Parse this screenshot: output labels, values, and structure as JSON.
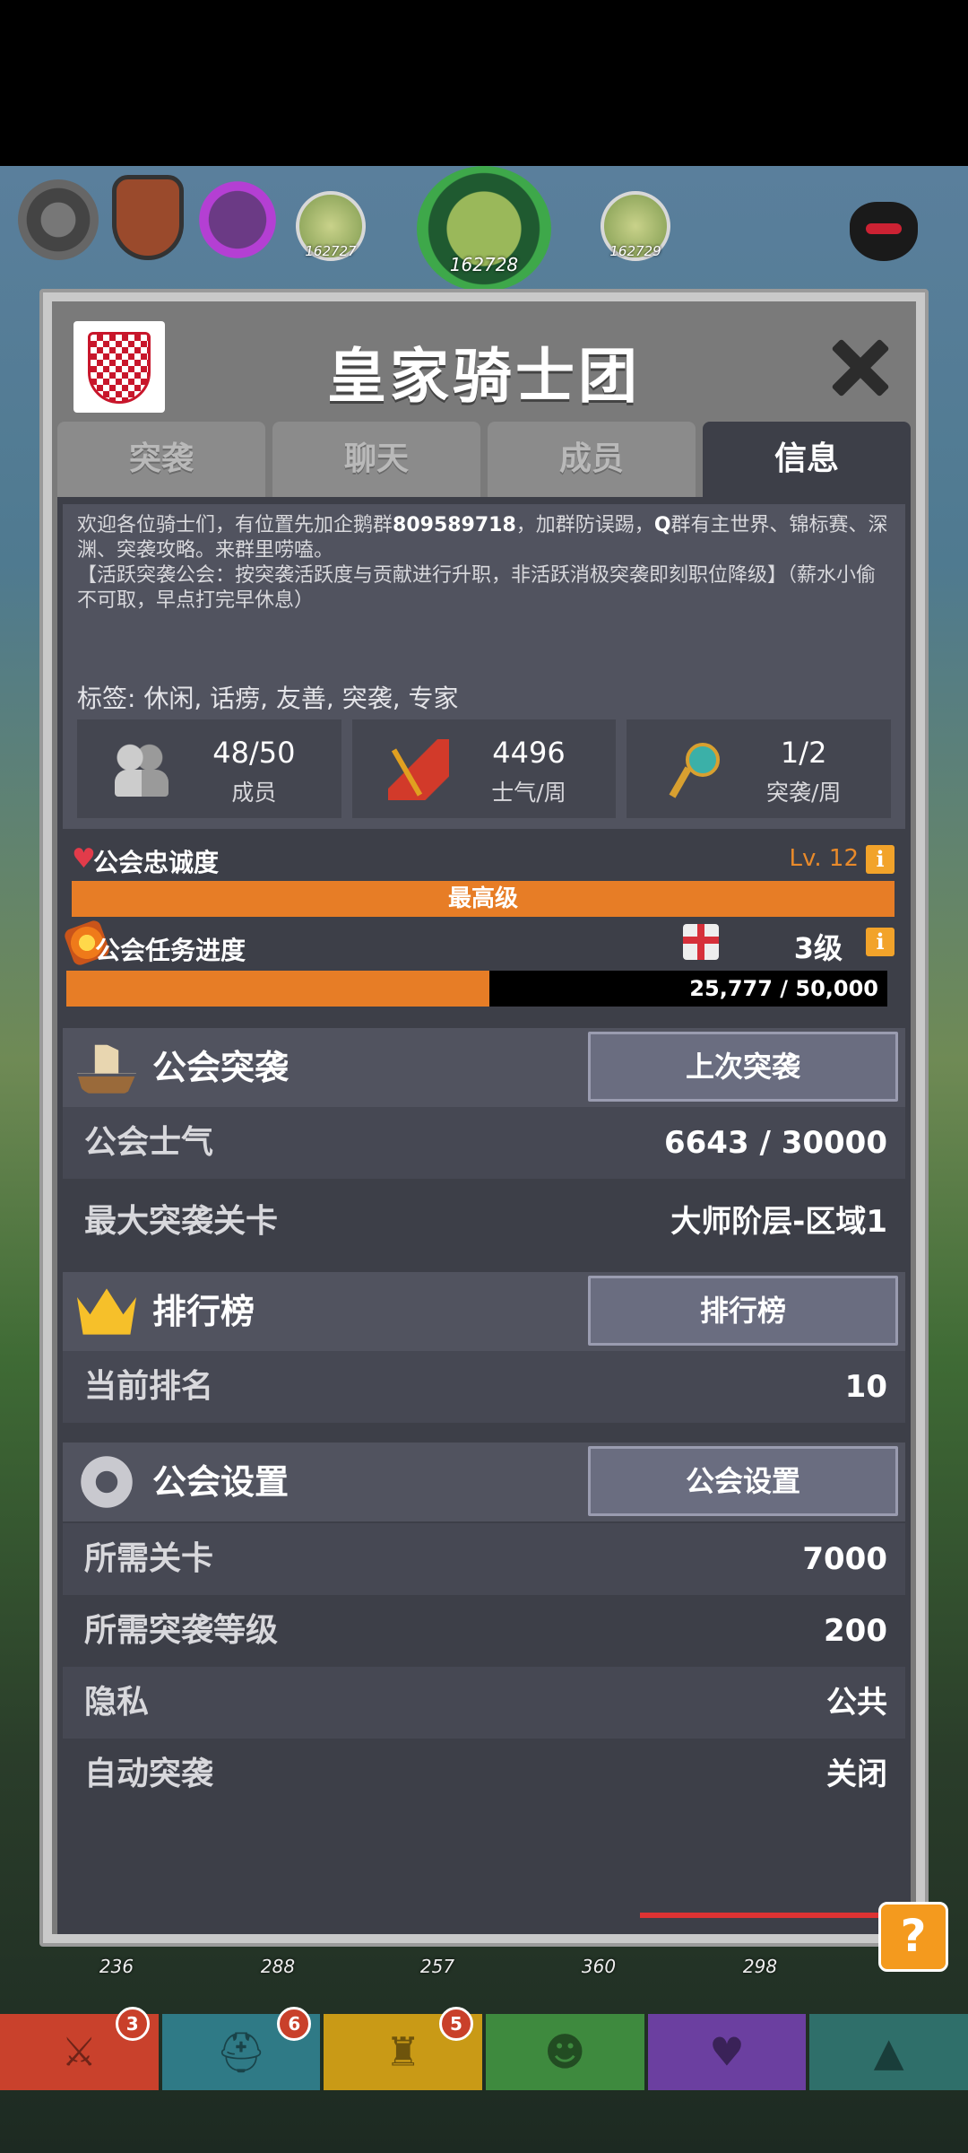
{
  "hud": {
    "levels": [
      {
        "label": "162727"
      },
      {
        "label": "162728"
      },
      {
        "label": "162729"
      }
    ]
  },
  "modal": {
    "title": "皇家骑士团",
    "tabs": [
      {
        "label": "突袭"
      },
      {
        "label": "聊天"
      },
      {
        "label": "成员"
      },
      {
        "label": "信息"
      }
    ],
    "active_tab": "信息",
    "description_lines": [
      "欢迎各位骑士们，有位置先加企鹅群",
      "809589718",
      "，加群防误踢，",
      "Q",
      "群有主世界、锦标赛、深渊、突袭攻略。来群里唠嗑。",
      "【活跃突袭公会：按突袭活跃度与贡献进行升职，非活跃消极突袭即刻职位降级】（薪水小偷不可取，早点打完早休息）"
    ],
    "tags": "标签: 休闲, 话痨, 友善, 突袭, 专家",
    "stats": [
      {
        "value": "48/50",
        "label": "成员",
        "icon": "people-icon"
      },
      {
        "value": "4496",
        "label": "士气/周",
        "icon": "flag-icon"
      },
      {
        "value": "1/2",
        "label": "突袭/周",
        "icon": "key-icon"
      }
    ],
    "loyalty": {
      "label": "公会忠诚度",
      "level": "Lv. 12",
      "bar_text": "最高级"
    },
    "task": {
      "label": "公会任务进度",
      "grade": "3级",
      "progress_text": "25,777 / 50,000",
      "current": 25777,
      "max": 50000
    },
    "raid_section": {
      "title": "公会突袭",
      "button": "上次突袭",
      "rows": [
        {
          "key": "公会士气",
          "value": "6643 / 30000"
        },
        {
          "key": "最大突袭关卡",
          "value": "大师阶层-区域1"
        }
      ]
    },
    "rank_section": {
      "title": "排行榜",
      "button": "排行榜",
      "rows": [
        {
          "key": "当前排名",
          "value": "10"
        }
      ]
    },
    "settings_section": {
      "title": "公会设置",
      "button": "公会设置",
      "rows": [
        {
          "key": "所需关卡",
          "value": "7000"
        },
        {
          "key": "所需突袭等级",
          "value": "200"
        },
        {
          "key": "隐私",
          "value": "公共"
        },
        {
          "key": "自动突袭",
          "value": "关闭"
        }
      ]
    }
  },
  "help_button": "?",
  "bottom": {
    "bubbles": [
      "236",
      "288",
      "257",
      "360",
      "298"
    ],
    "tabs": [
      {
        "color": "#c9412c",
        "badge": "3",
        "icon": "sword-icon"
      },
      {
        "color": "#2f7a86",
        "badge": "6",
        "icon": "helmet-icon"
      },
      {
        "color": "#c99a16",
        "badge": "5",
        "icon": "armor-icon"
      },
      {
        "color": "#3e8a3e",
        "badge": "",
        "icon": "demon-icon"
      },
      {
        "color": "#6b3fa0",
        "badge": "",
        "icon": "heart-icon"
      },
      {
        "color": "#2f6f6a",
        "badge": "",
        "icon": "shop-icon"
      }
    ]
  },
  "colors": {
    "panel_dark": "#3d3f48",
    "panel_mid": "#51535f",
    "accent_orange": "#e77d26",
    "button": "#6a6d80"
  }
}
